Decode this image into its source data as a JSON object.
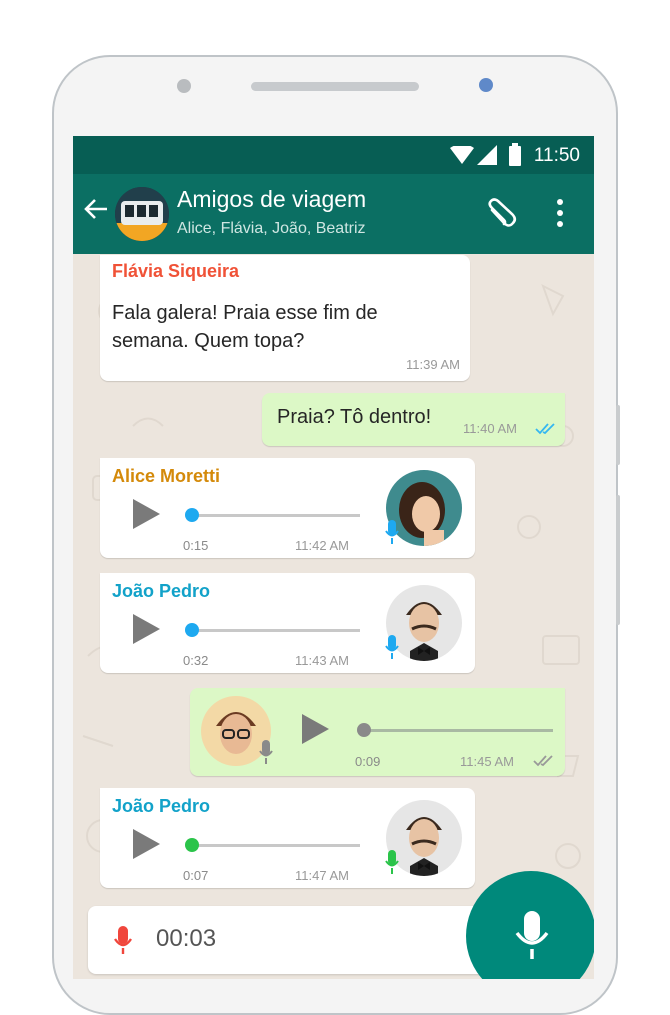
{
  "status": {
    "time": "11:50"
  },
  "header": {
    "title": "Amigos de viagem",
    "members": "Alice, Flávia, João, Beatriz"
  },
  "messages": {
    "m1": {
      "sender": "Flávia Siqueira",
      "text": "Fala galera! Praia esse fim de semana. Quem topa?",
      "time": "11:39 AM"
    },
    "m2": {
      "text": "Praia? Tô dentro!",
      "time": "11:40 AM"
    },
    "m3": {
      "sender": "Alice Moretti",
      "duration": "0:15",
      "time": "11:42 AM",
      "progress": 0
    },
    "m4": {
      "sender": "João Pedro",
      "duration": "0:32",
      "time": "11:43 AM",
      "progress": 0
    },
    "m5": {
      "duration": "0:09",
      "time": "11:45 AM",
      "progress": 0
    },
    "m6": {
      "sender": "João Pedro",
      "duration": "0:07",
      "time": "11:47 AM",
      "progress": 0
    }
  },
  "recorder": {
    "elapsed": "00:03"
  },
  "colors": {
    "header": "#0b6f63",
    "statusbar": "#075e54",
    "chat_bg": "#ece5dd",
    "outgoing": "#dcf8c6",
    "incoming": "#ffffff",
    "fab": "#00897b",
    "flavia": "#f05237",
    "alice": "#d48a0a",
    "joao": "#12a2c9",
    "read_ticks": "#34b7f1",
    "voice_unplayed": "#1ea9f0",
    "voice_played": "#2bc44a",
    "recording": "#f0463c"
  },
  "icons": [
    "back-arrow-icon",
    "wifi-icon",
    "signal-icon",
    "battery-icon",
    "paperclip-icon",
    "more-vert-icon",
    "play-icon",
    "mic-icon",
    "double-check-icon"
  ]
}
